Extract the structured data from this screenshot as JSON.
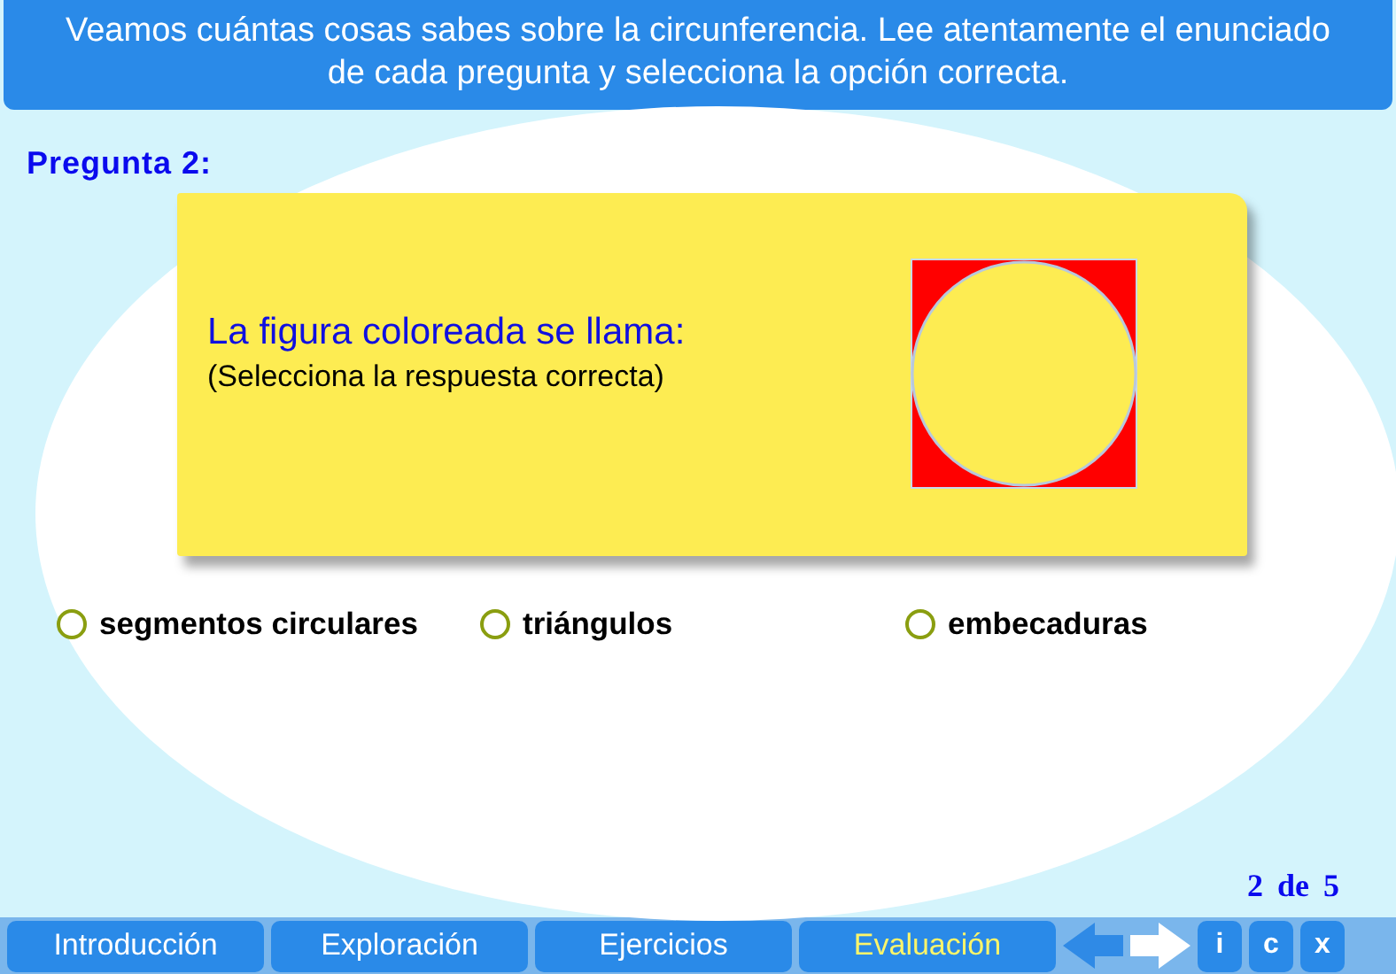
{
  "header": {
    "text": "Veamos cuántas cosas sabes sobre la circunferencia. Lee atentamente el enunciado de cada pregunta y selecciona la opción correcta."
  },
  "question": {
    "label": "Pregunta 2:",
    "prompt": "La figura coloreada se llama:",
    "hint": "(Selecciona la respuesta correcta)"
  },
  "options": [
    {
      "label": "segmentos circulares",
      "selected": false
    },
    {
      "label": "triángulos",
      "selected": false
    },
    {
      "label": "embecaduras",
      "selected": false
    }
  ],
  "pager": {
    "current": "2",
    "sep": "de",
    "total": "5"
  },
  "tabs": [
    {
      "label": "Introducción",
      "selected": false
    },
    {
      "label": "Exploración",
      "selected": false
    },
    {
      "label": "Ejercicios",
      "selected": false
    },
    {
      "label": "Evaluación",
      "selected": true
    }
  ],
  "small_buttons": [
    "i",
    "c",
    "x"
  ]
}
